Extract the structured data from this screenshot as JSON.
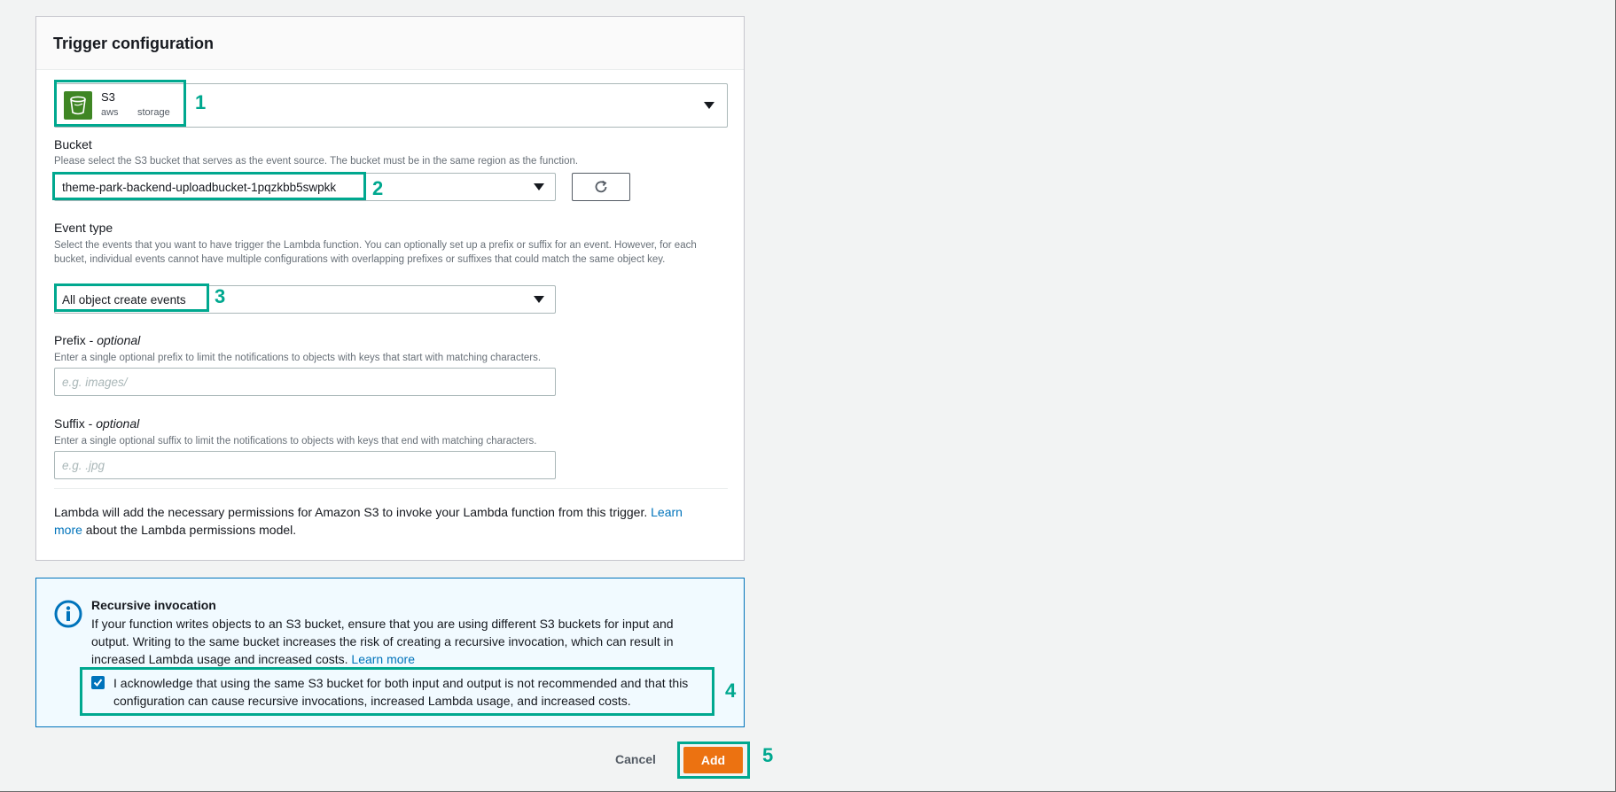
{
  "panel": {
    "title": "Trigger configuration"
  },
  "source": {
    "name": "S3",
    "tag_provider": "aws",
    "tag_category": "storage",
    "icon": "s3-bucket-icon"
  },
  "bucket": {
    "label": "Bucket",
    "description": "Please select the S3 bucket that serves as the event source. The bucket must be in the same region as the function.",
    "value": "theme-park-backend-uploadbucket-1pqzkbb5swpkk"
  },
  "event_type": {
    "label": "Event type",
    "description": "Select the events that you want to have trigger the Lambda function. You can optionally set up a prefix or suffix for an event. However, for each bucket, individual events cannot have multiple configurations with overlapping prefixes or suffixes that could match the same object key.",
    "value": "All object create events"
  },
  "prefix": {
    "label": "Prefix - ",
    "label_optional": "optional",
    "description": "Enter a single optional prefix to limit the notifications to objects with keys that start with matching characters.",
    "placeholder": "e.g. images/"
  },
  "suffix": {
    "label": "Suffix - ",
    "label_optional": "optional",
    "description": "Enter a single optional suffix to limit the notifications to objects with keys that end with matching characters.",
    "placeholder": "e.g. .jpg"
  },
  "permissions": {
    "text_before": "Lambda will add the necessary permissions for Amazon S3 to invoke your Lambda function from this trigger. ",
    "link": "Learn more",
    "text_after": " about the Lambda permissions model."
  },
  "recursive": {
    "title": "Recursive invocation",
    "body": "If your function writes objects to an S3 bucket, ensure that you are using different S3 buckets for input and output. Writing to the same bucket increases the risk of creating a recursive invocation, which can result in increased Lambda usage and increased costs. ",
    "link": "Learn more",
    "acknowledge_text": "I acknowledge that using the same S3 bucket for both input and output is not recommended and that this configuration can cause recursive invocations, increased Lambda usage, and increased costs.",
    "acknowledge_checked": true
  },
  "actions": {
    "cancel_label": "Cancel",
    "add_label": "Add"
  },
  "annotations": [
    "1",
    "2",
    "3",
    "4",
    "5"
  ],
  "colors": {
    "highlight": "#00a88f",
    "primary_button": "#ec7211",
    "link": "#0073bb",
    "s3_icon_bg": "#3f8624"
  }
}
